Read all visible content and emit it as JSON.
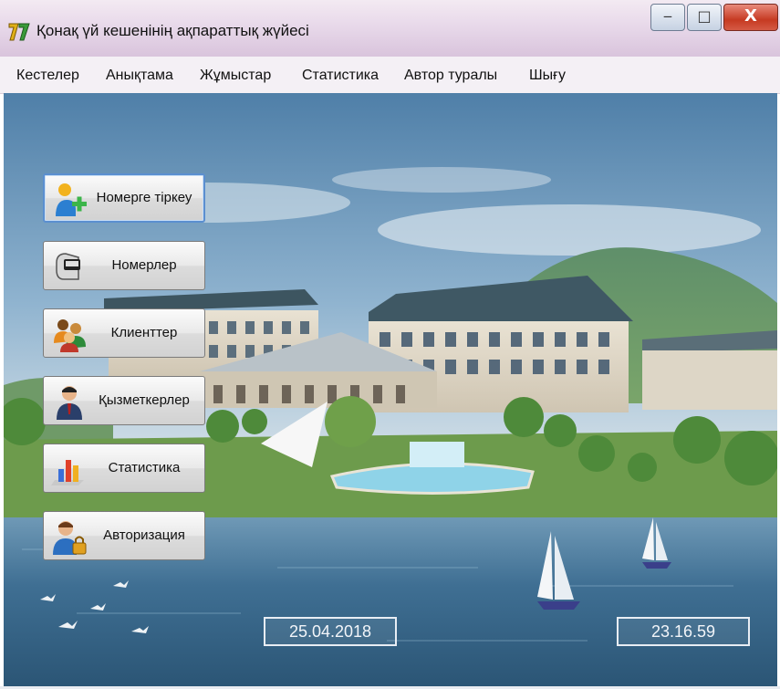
{
  "window": {
    "title": "Қонақ үй кешенінің ақпараттық жүйесі",
    "minimize_glyph": "‒",
    "maximize_glyph": "□",
    "close_glyph": "X"
  },
  "menu": {
    "items": [
      "Кестелер",
      "Анықтама",
      "Жұмыстар",
      "Статистика",
      "Автор туралы",
      "Шығу"
    ]
  },
  "buttons": [
    {
      "label": "Номерге тіркеу",
      "icon": "person-add-icon"
    },
    {
      "label": "Номерлер",
      "icon": "card-reader-icon"
    },
    {
      "label": "Клиенттер",
      "icon": "clients-icon"
    },
    {
      "label": "Қызметкерлер",
      "icon": "employee-icon"
    },
    {
      "label": "Статистика",
      "icon": "bar-chart-icon"
    },
    {
      "label": "Авторизация",
      "icon": "user-lock-icon"
    }
  ],
  "status": {
    "date": "25.04.2018",
    "time": "23.16.59"
  },
  "colors": {
    "titlebar": "#e8d9ea",
    "close_button": "#c63a22",
    "sky": "#7fa7c8",
    "water": "#3f6f93"
  }
}
